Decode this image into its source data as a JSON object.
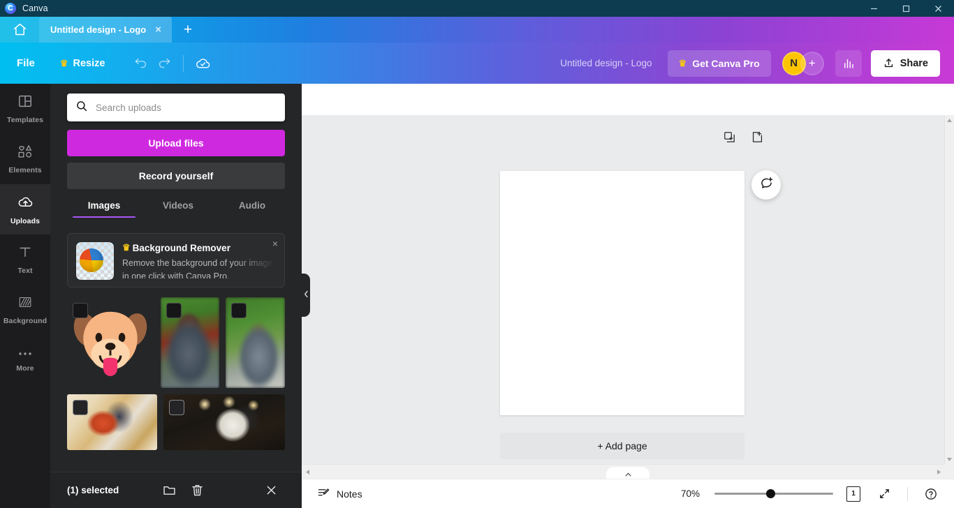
{
  "titlebar": {
    "app_name": "Canva",
    "logo_letter": "C",
    "minimize": "minimize-icon",
    "maximize": "maximize-icon",
    "close": "close-icon"
  },
  "tabstrip": {
    "home_icon": "home-icon",
    "tab_label": "Untitled design - Logo",
    "tab_close": "×",
    "new_tab": "+"
  },
  "toolbar": {
    "file_label": "File",
    "resize_label": "Resize",
    "crown": "♛",
    "undo_icon": "undo-icon",
    "redo_icon": "redo-icon",
    "cloud_icon": "cloud-saved-icon",
    "doc_title": "Untitled design - Logo",
    "pro_label": "Get Canva Pro",
    "avatar_initial": "N",
    "avatar_plus": "+",
    "stats_icon": "bar-chart-icon",
    "share_label": "Share"
  },
  "rail": {
    "items": [
      {
        "label": "Templates",
        "icon": "templates-icon",
        "active": false
      },
      {
        "label": "Elements",
        "icon": "elements-icon",
        "active": false
      },
      {
        "label": "Uploads",
        "icon": "uploads-cloud-icon",
        "active": true
      },
      {
        "label": "Text",
        "icon": "text-icon",
        "active": false
      },
      {
        "label": "Background",
        "icon": "background-icon",
        "active": false
      },
      {
        "label": "More",
        "icon": "more-dots-icon",
        "active": false
      }
    ]
  },
  "panel": {
    "search_placeholder": "Search uploads",
    "search_value": "",
    "search_icon": "search-icon",
    "upload_button": "Upload files",
    "record_button": "Record yourself",
    "tabs": [
      {
        "label": "Images",
        "active": true
      },
      {
        "label": "Videos",
        "active": false
      },
      {
        "label": "Audio",
        "active": false
      }
    ],
    "promo": {
      "title": "Background Remover",
      "crown": "♛",
      "description": "Remove the background of your image in one click with Canva Pro.",
      "close": "×",
      "thumb": "beachball-checker-icon"
    },
    "thumbnails": [
      {
        "name": "dog-emoji-thumbnail",
        "selected": true
      },
      {
        "name": "park-portrait-thumbnail-1",
        "selected": true
      },
      {
        "name": "park-portrait-thumbnail-2",
        "selected": true
      },
      {
        "name": "dance-painting-thumbnail",
        "selected": true
      },
      {
        "name": "dance-photo-thumbnail",
        "selected": true
      }
    ],
    "actions": {
      "selected_text": "(1) selected",
      "folder_icon": "folder-icon",
      "trash_icon": "trash-icon",
      "close_icon": "close-icon"
    },
    "collapse_icon": "chevron-left-icon"
  },
  "canvas": {
    "duplicate_page_icon": "duplicate-page-icon",
    "add_page_icon": "add-page-icon",
    "comment_icon": "add-comment-icon",
    "add_page_label": "+ Add page"
  },
  "statusbar": {
    "notes_label": "Notes",
    "notes_icon": "notes-icon",
    "zoom_level": "70%",
    "page_count": "1",
    "fullscreen_icon": "fullscreen-icon",
    "help_icon": "help-icon",
    "collapse_icon": "chevron-up-icon"
  },
  "colors": {
    "brand_cyan": "#00bff0",
    "brand_purple": "#8947d4",
    "brand_magenta": "#c93ad5",
    "upload_button": "#cf29e0",
    "tab_underline": "#a855f7",
    "avatar_yellow": "#ffc400",
    "panel_bg": "#252627",
    "rail_bg": "#1c1c1e",
    "canvas_bg": "#eaebec"
  }
}
